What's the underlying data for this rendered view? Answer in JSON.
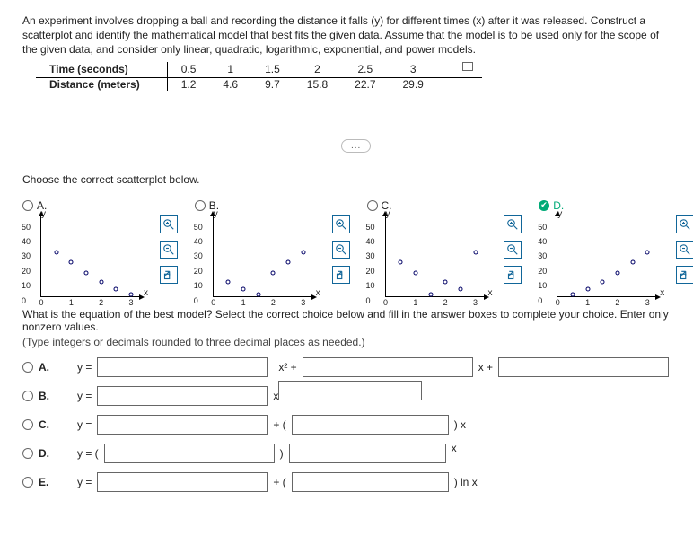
{
  "instruction": "An experiment involves dropping a ball and recording the distance it falls (y) for different times (x) after it was released. Construct a scatterplot and identify the mathematical model that best fits the given data. Assume that the model is to be used only for the scope of the given data, and consider only linear, quadratic, logarithmic, exponential, and power models.",
  "table": {
    "row1_label": "Time (seconds)",
    "row2_label": "Distance (meters)",
    "cols": [
      "0.5",
      "1",
      "1.5",
      "2",
      "2.5",
      "3"
    ],
    "row2": [
      "1.2",
      "4.6",
      "9.7",
      "15.8",
      "22.7",
      "29.9"
    ]
  },
  "section_title": "Choose the correct scatterplot below.",
  "ellipsis": "...",
  "controls": {
    "zoomin": "zoom-in",
    "zoomout": "zoom-out",
    "popout": "open-in-new"
  },
  "plots": {
    "labels": [
      "A.",
      "B.",
      "C.",
      "D."
    ],
    "ylabel": "y",
    "xlabel": "x",
    "yticks": [
      "0",
      "10",
      "20",
      "30",
      "40",
      "50"
    ],
    "xticks": [
      "0",
      "1",
      "2",
      "3"
    ]
  },
  "equation_question": "What is the equation of the best model? Select the correct choice below and fill in the answer boxes to complete your choice. Enter only nonzero values.",
  "equation_note": "(Type integers or decimals rounded to three decimal places as needed.)",
  "choices": {
    "a": {
      "lbl": "A.",
      "pre": "y = ",
      "mid": "x² + ",
      "post": "x + "
    },
    "b": {
      "lbl": "B.",
      "pre": "y = ",
      "mid": "x"
    },
    "c": {
      "lbl": "C.",
      "pre": "y = ",
      "mid": "+ (",
      "post": ") x"
    },
    "d": {
      "lbl": "D.",
      "pre": "y = (",
      "mid": ")",
      "post": "x"
    },
    "e": {
      "lbl": "E.",
      "pre": "y = ",
      "mid": "+ (",
      "post": ") ln x"
    }
  },
  "chart_data": [
    {
      "plot": "A",
      "type": "scatter",
      "xlim": [
        0,
        3.3
      ],
      "ylim": [
        0,
        55
      ],
      "xticks": [
        0,
        1,
        2,
        3
      ],
      "yticks": [
        0,
        10,
        20,
        30,
        40,
        50
      ],
      "points": [
        [
          0.5,
          29.9
        ],
        [
          1,
          22.7
        ],
        [
          1.5,
          15.8
        ],
        [
          2,
          9.7
        ],
        [
          2.5,
          4.6
        ],
        [
          3,
          1.2
        ]
      ]
    },
    {
      "plot": "B",
      "type": "scatter",
      "xlim": [
        0,
        3.3
      ],
      "ylim": [
        0,
        55
      ],
      "xticks": [
        0,
        1,
        2,
        3
      ],
      "yticks": [
        0,
        10,
        20,
        30,
        40,
        50
      ],
      "points": [
        [
          0.5,
          9.7
        ],
        [
          1,
          4.6
        ],
        [
          1.5,
          1.2
        ],
        [
          2,
          15.8
        ],
        [
          2.5,
          22.7
        ],
        [
          3,
          29.9
        ]
      ]
    },
    {
      "plot": "C",
      "type": "scatter",
      "xlim": [
        0,
        3.3
      ],
      "ylim": [
        0,
        55
      ],
      "xticks": [
        0,
        1,
        2,
        3
      ],
      "yticks": [
        0,
        10,
        20,
        30,
        40,
        50
      ],
      "points": [
        [
          0.5,
          22.7
        ],
        [
          1,
          15.8
        ],
        [
          1.5,
          1.2
        ],
        [
          2,
          9.7
        ],
        [
          2.5,
          4.6
        ],
        [
          3,
          29.9
        ]
      ]
    },
    {
      "plot": "D",
      "type": "scatter",
      "xlim": [
        0,
        3.3
      ],
      "ylim": [
        0,
        55
      ],
      "xticks": [
        0,
        1,
        2,
        3
      ],
      "yticks": [
        0,
        10,
        20,
        30,
        40,
        50
      ],
      "points": [
        [
          0.5,
          1.2
        ],
        [
          1,
          4.6
        ],
        [
          1.5,
          9.7
        ],
        [
          2,
          15.8
        ],
        [
          2.5,
          22.7
        ],
        [
          3,
          29.9
        ]
      ]
    }
  ]
}
